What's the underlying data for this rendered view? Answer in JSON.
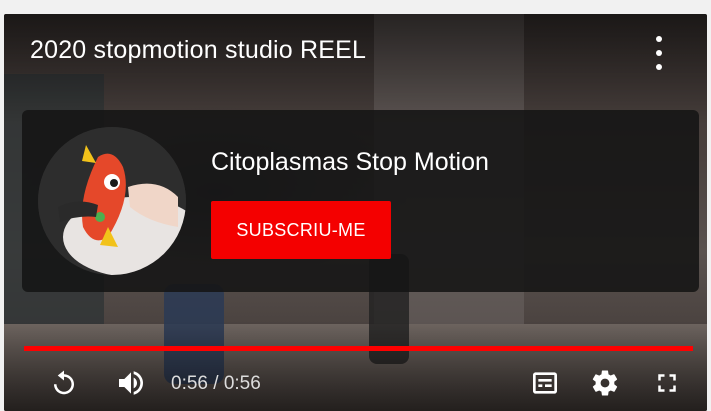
{
  "video": {
    "title": "2020 stopmotion studio REEL"
  },
  "endcard": {
    "channel_name": "Citoplasmas Stop Motion",
    "subscribe_label": "SUBSCRIU-ME"
  },
  "player": {
    "current_time": "0:56",
    "duration": "0:56",
    "time_separator": " / ",
    "progress_fraction": 1.0,
    "accent_color": "#ff0000",
    "subscribe_color": "#f40000"
  },
  "icons": {
    "more": "more-vert-icon",
    "replay": "replay-icon",
    "volume": "volume-icon",
    "captions": "captions-icon",
    "settings": "gear-icon",
    "fullscreen": "fullscreen-icon"
  }
}
